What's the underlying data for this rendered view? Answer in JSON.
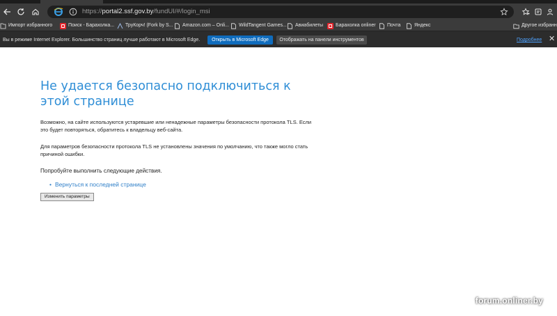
{
  "browser": {
    "url": {
      "prefix": "https://",
      "host": "portal2.ssf.gov.by",
      "path": "/fundUI/#/login_msi"
    },
    "favorites": [
      {
        "label": "Импорт избранного",
        "icon": "import-icon"
      },
      {
        "label": "Поиск - Барахолка...",
        "icon": "onliner-icon"
      },
      {
        "label": "ТруКорч! (Fork by S...",
        "icon": "bookmark-icon"
      },
      {
        "label": "Amazon.com – Onli...",
        "icon": "page-icon"
      },
      {
        "label": "WildTangent Games...",
        "icon": "page-icon"
      },
      {
        "label": "Авиабилеты",
        "icon": "page-icon"
      },
      {
        "label": "Барахолка onliner",
        "icon": "onliner-icon"
      },
      {
        "label": "Почта",
        "icon": "page-icon"
      },
      {
        "label": "Яндекс",
        "icon": "page-icon"
      }
    ],
    "other_favorites": "Другое избранное",
    "ie_mode": {
      "message": "Вы в режиме Internet Explorer. Большинство страниц лучше работают в Microsoft Edge.",
      "open_button": "Открыть в Microsoft Edge",
      "show_button": "Отображать на панели инструментов",
      "more_link": "Подробнее"
    },
    "colors": {
      "accent": "#0f6cbd",
      "chrome": "#3b3b3b",
      "onliner_red": "#e4252d"
    }
  },
  "error_page": {
    "title": "Не удается безопасно подключиться к этой странице",
    "paragraph1": "Возможно, на сайте используются устаревшие или ненадежные параметры безопасности протокола TLS. Если это будет повторяться, обратитесь к владельцу веб-сайта.",
    "paragraph2": "Для параметров безопасности протокола TLS не установлены значения по умолчанию, что также могло стать причиной ошибки.",
    "try_text": "Попробуйте выполнить следующие действия.",
    "actions": [
      "Вернуться к последней странице"
    ],
    "change_settings_button": "Изменить параметры",
    "colors": {
      "title": "#2f8ed6",
      "link": "#2f7fc8"
    }
  },
  "watermark": "forum.onliner.by"
}
